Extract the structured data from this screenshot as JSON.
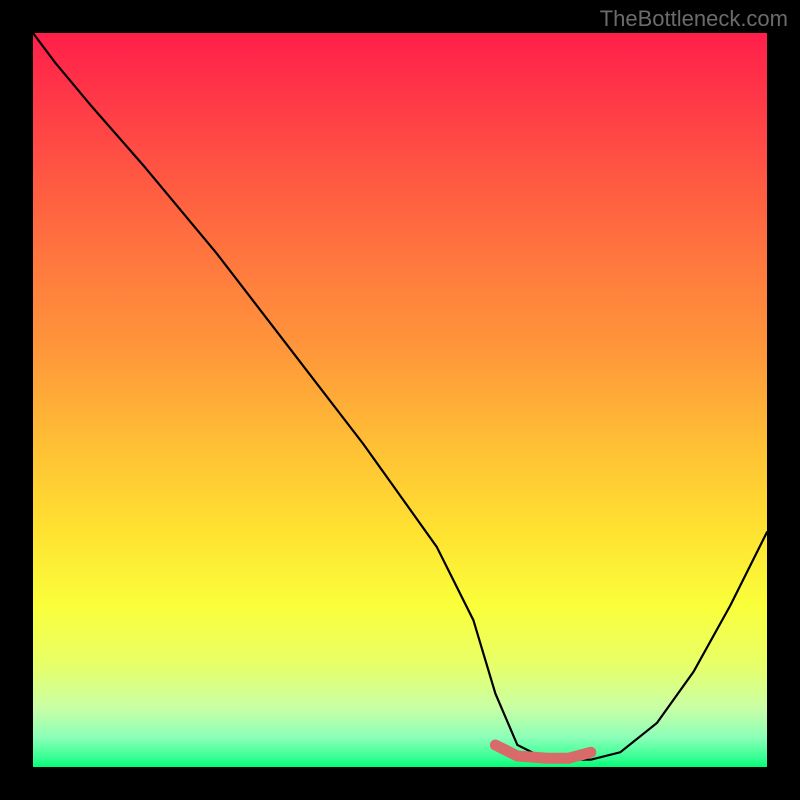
{
  "watermark": "TheBottleneck.com",
  "chart_data": {
    "type": "line",
    "title": "",
    "xlabel": "",
    "ylabel": "",
    "xlim": [
      0,
      100
    ],
    "ylim": [
      0,
      100
    ],
    "series": [
      {
        "name": "bottleneck-curve",
        "x": [
          0,
          3,
          8,
          15,
          25,
          35,
          45,
          55,
          60,
          63,
          66,
          70,
          73,
          76,
          80,
          85,
          90,
          95,
          100
        ],
        "values": [
          100,
          96,
          90,
          82,
          70,
          57,
          44,
          30,
          20,
          10,
          3,
          1,
          1,
          1,
          2,
          6,
          13,
          22,
          32
        ]
      },
      {
        "name": "highlight-band",
        "x": [
          63,
          66,
          70,
          73,
          76
        ],
        "values": [
          3,
          1.5,
          1.2,
          1.2,
          2
        ]
      }
    ],
    "gradient_stops": [
      {
        "pos": 0,
        "color": "#ff1f4a"
      },
      {
        "pos": 50,
        "color": "#ffbf35"
      },
      {
        "pos": 80,
        "color": "#faff3a"
      },
      {
        "pos": 100,
        "color": "#00ff73"
      }
    ],
    "background_color": "#000000",
    "highlight_color": "#d86a6a"
  }
}
